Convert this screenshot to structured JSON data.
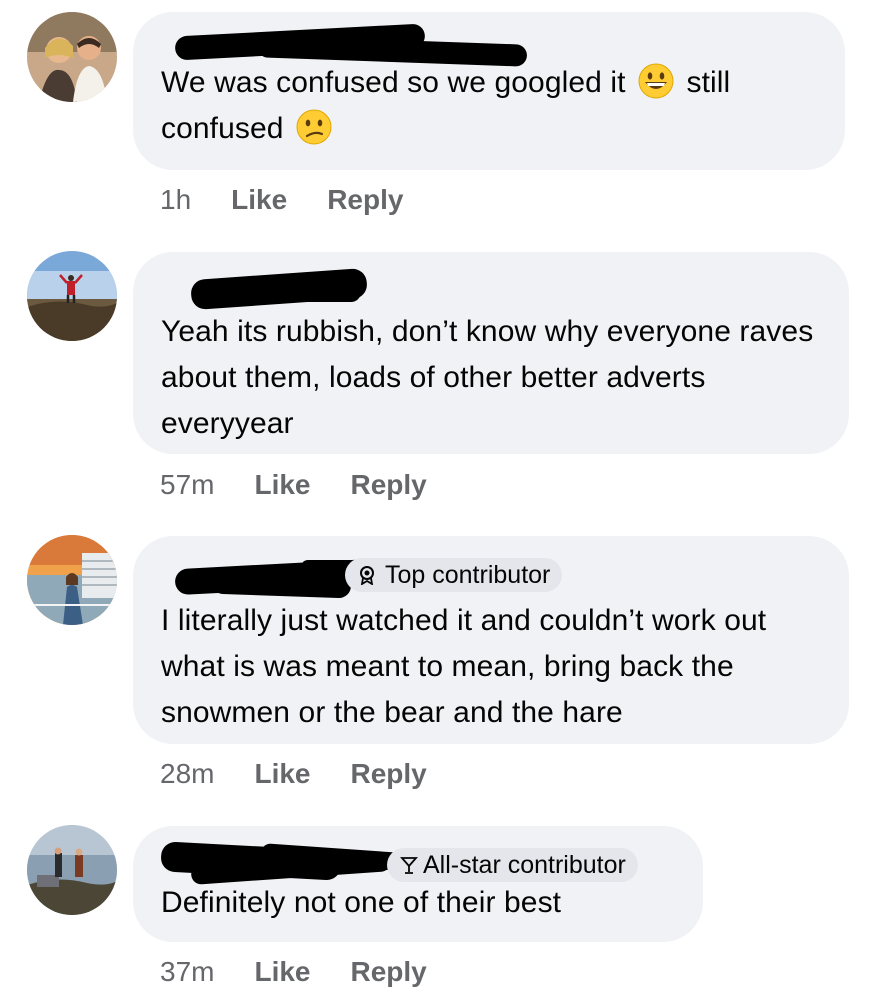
{
  "comments": [
    {
      "text_line1": "We was confused so we googled it",
      "text_after_emoji": "still",
      "text_line2": "confused",
      "emoji1": "grinning-face-emoji",
      "emoji2": "confused-face-emoji",
      "time": "1h",
      "like": "Like",
      "reply": "Reply"
    },
    {
      "text": "Yeah its rubbish, don’t know why everyone raves about them, loads of other better adverts everyyear",
      "time": "57m",
      "like": "Like",
      "reply": "Reply"
    },
    {
      "badge": "Top contributor",
      "text": "I literally just watched it and couldn’t work out what is was meant to mean, bring back the snowmen or the bear and the hare",
      "time": "28m",
      "like": "Like",
      "reply": "Reply"
    },
    {
      "badge": "All-star contributor",
      "text": "Definitely not one of their best",
      "time": "37m",
      "like": "Like",
      "reply": "Reply"
    }
  ],
  "colors": {
    "bubble": "#f0f2f5",
    "badge": "#e4e6eb",
    "meta": "#65676b",
    "text": "#050505"
  }
}
